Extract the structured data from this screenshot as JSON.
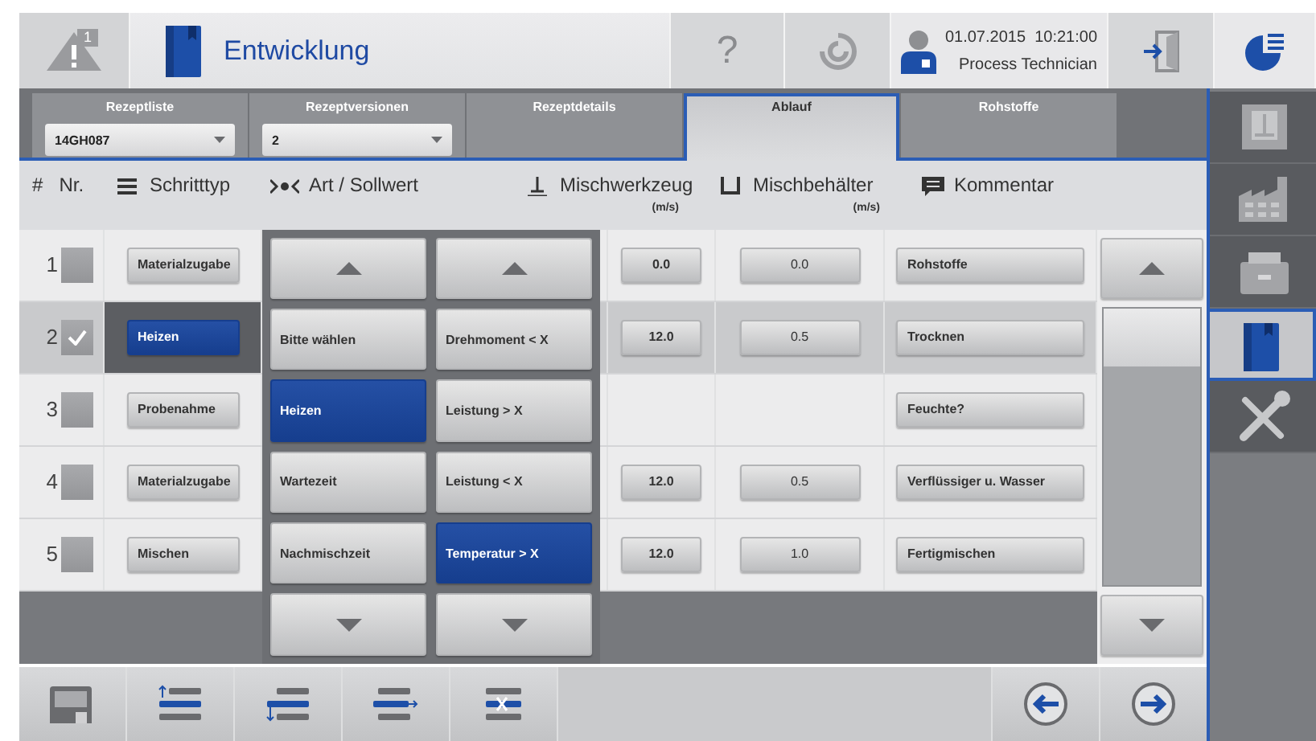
{
  "header": {
    "alarm_count": "1",
    "title": "Entwicklung",
    "help": "?",
    "date": "01.07.2015",
    "time": "10:21:00",
    "user_role": "Process Technician"
  },
  "tabs": [
    {
      "label": "Rezeptliste",
      "selected": false,
      "value": "14GH087"
    },
    {
      "label": "Rezeptversionen",
      "selected": false,
      "value": "2"
    },
    {
      "label": "Rezeptdetails",
      "selected": false
    },
    {
      "label": "Ablauf",
      "selected": true
    },
    {
      "label": "Rohstoffe",
      "selected": false
    }
  ],
  "columns": [
    {
      "kind": "number",
      "symbol": "#",
      "label": "Nr."
    },
    {
      "kind": "type",
      "label": "Schritttyp"
    },
    {
      "kind": "mode",
      "label": "Art / Sollwert"
    },
    {
      "kind": "tool",
      "label": "Mischwerkzeug",
      "unit": "(m/s)"
    },
    {
      "kind": "vessel",
      "label": "Mischbehälter",
      "unit": "(m/s)"
    },
    {
      "kind": "comment",
      "label": "Kommentar"
    }
  ],
  "rows": [
    {
      "number": "1",
      "checked": false,
      "selected": false,
      "type": "Materialzugabe",
      "tool": "0.0",
      "vessel": "0.0",
      "comment": "Rohstoffe"
    },
    {
      "number": "2",
      "checked": true,
      "selected": true,
      "type": "Heizen",
      "tool": "12.0",
      "vessel": "0.5",
      "comment": "Trocknen"
    },
    {
      "number": "3",
      "checked": false,
      "selected": false,
      "type": "Probenahme",
      "comment": "Feuchte?"
    },
    {
      "number": "4",
      "checked": false,
      "selected": false,
      "type": "Materialzugabe",
      "tool": "12.0",
      "vessel": "0.5",
      "comment": "Verflüssiger u. Wasser"
    },
    {
      "number": "5",
      "checked": false,
      "selected": false,
      "type": "Mischen",
      "tool": "12.0",
      "vessel": "1.0",
      "comment": "Fertigmischen"
    }
  ],
  "picker": [
    {
      "items": [
        {
          "label": "Bitte wählen",
          "selected": false
        },
        {
          "label": "Heizen",
          "selected": true
        },
        {
          "label": "Wartezeit",
          "selected": false
        },
        {
          "label": "Nachmischzeit",
          "selected": false
        }
      ]
    },
    {
      "items": [
        {
          "label": "Drehmoment < X",
          "selected": false
        },
        {
          "label": "Leistung > X",
          "selected": false
        },
        {
          "label": "Leistung < X",
          "selected": false
        },
        {
          "label": "Temperatur > X",
          "selected": true
        }
      ]
    }
  ],
  "nav": [
    {
      "kind": "plate",
      "selected": false
    },
    {
      "kind": "factory",
      "selected": false
    },
    {
      "kind": "toolbox",
      "selected": false
    },
    {
      "kind": "book",
      "selected": true
    },
    {
      "kind": "tools",
      "selected": false
    }
  ]
}
